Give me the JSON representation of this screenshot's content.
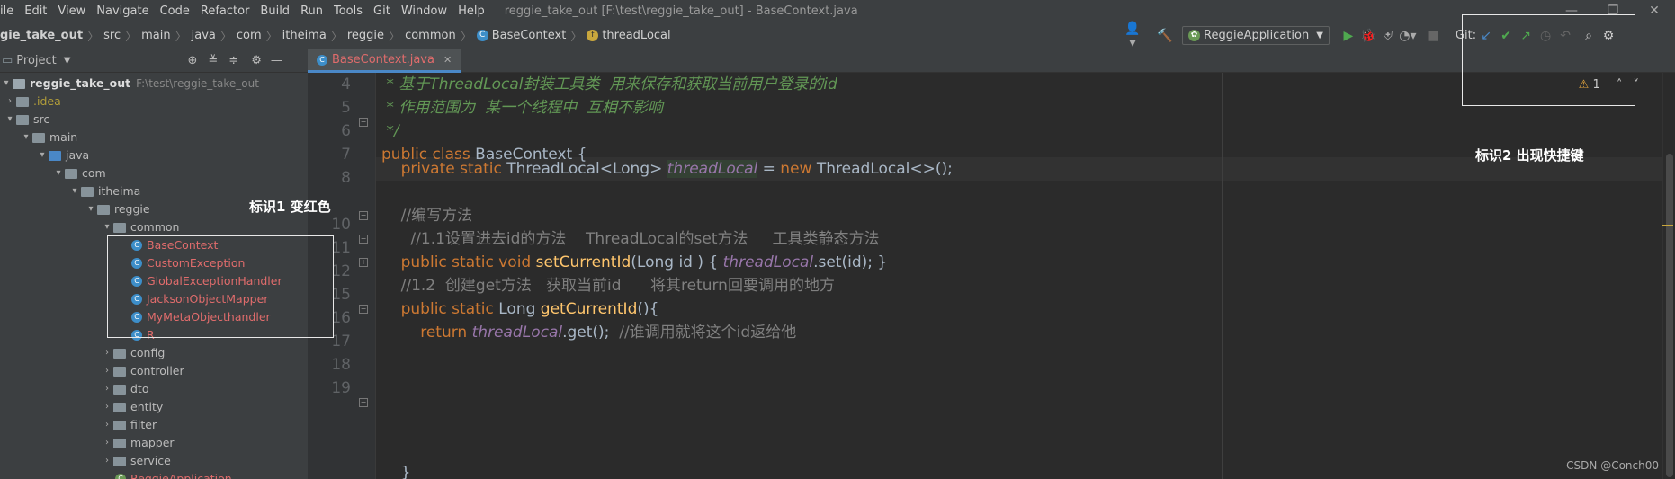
{
  "menu": [
    "ile",
    "Edit",
    "View",
    "Navigate",
    "Code",
    "Refactor",
    "Build",
    "Run",
    "Tools",
    "Git",
    "Window",
    "Help"
  ],
  "window_title": "reggie_take_out [F:\\test\\reggie_take_out] - BaseContext.java",
  "breadcrumb": [
    "gie_take_out",
    "src",
    "main",
    "java",
    "com",
    "itheima",
    "reggie",
    "common",
    "BaseContext",
    "threadLocal"
  ],
  "run_config": "ReggieApplication",
  "git_label": "Git:",
  "project_tool": {
    "title": "Project"
  },
  "tree": {
    "root_name": "reggie_take_out",
    "root_path": "F:\\test\\reggie_take_out",
    "idea": ".idea",
    "src": "src",
    "main": "main",
    "java": "java",
    "com": "com",
    "itheima": "itheima",
    "reggie": "reggie",
    "common": "common",
    "common_items": [
      "BaseContext",
      "CustomException",
      "GlobalExceptionHandler",
      "JacksonObjectMapper",
      "MyMetaObjecthandler",
      "R"
    ],
    "packages": [
      "config",
      "controller",
      "dto",
      "entity",
      "filter",
      "mapper",
      "service"
    ],
    "last": "ReggieApplication"
  },
  "tab": {
    "label": "BaseContext.java"
  },
  "warnings": "1",
  "code": {
    "line_numbers": [
      "4",
      "5",
      "6",
      "7",
      "8",
      "",
      "10",
      "11",
      "12",
      "15",
      "16",
      "17",
      "18",
      "19"
    ],
    "l4": " * 基于ThreadLocal封装工具类  用来保存和获取当前用户登录的id",
    "l5": " * 作用范围为  某一个线程中  互相不影响",
    "l6": " */",
    "l7_kw": "public class ",
    "l7_tx": "BaseContext {",
    "l8_kw": "    private static ",
    "l8_tx": "ThreadLocal<Long> ",
    "l8_fld": "threadLocal",
    "l8_eq": " = ",
    "l8_new": "new ",
    "l8_end": "ThreadLocal<>();",
    "l10": "    //编写方法",
    "l11": "      //1.1设置进去id的方法    ThreadLocal的set方法     工具类静态方法",
    "l12_kw": "    public static void ",
    "l12_fn": "setCurrentId",
    "l12_a": "(Long id ) { ",
    "l12_fld": "threadLocal",
    "l12_b": ".set(id); }",
    "l15": "    //1.2  创建get方法   获取当前id      将其return回要调用的地方",
    "l16_kw": "    public static ",
    "l16_tx": "Long ",
    "l16_fn": "getCurrentId",
    "l16_b": "(){",
    "l17_kw": "        return ",
    "l17_fld": "threadLocal",
    "l17_b": ".get();  ",
    "l17_c": "//谁调用就将这个id返给他",
    "l20": "    }"
  },
  "annotations": {
    "mark1": "标识1  变红色",
    "mark2": "标识2  出现快捷键"
  },
  "watermark": "CSDN @Conch00"
}
